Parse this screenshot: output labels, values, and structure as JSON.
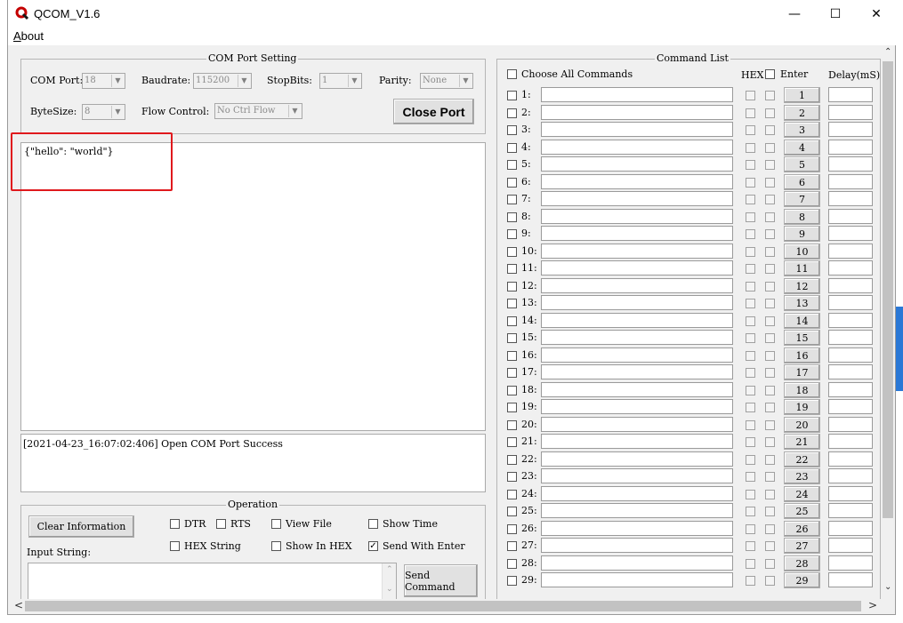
{
  "window": {
    "title": "QCOM_V1.6",
    "minimize_glyph": "—",
    "maximize_glyph": "☐",
    "close_glyph": "✕",
    "app_icon": "qcom-logo-icon"
  },
  "menu": {
    "about_label": "About"
  },
  "com_port_setting": {
    "title": "COM Port Setting",
    "com_port_label": "COM Port:",
    "com_port_value": "18",
    "baudrate_label": "Baudrate:",
    "baudrate_value": "115200",
    "stopbits_label": "StopBits:",
    "stopbits_value": "1",
    "parity_label": "Parity:",
    "parity_value": "None",
    "bytesize_label": "ByteSize:",
    "bytesize_value": "8",
    "flow_control_label": "Flow Control:",
    "flow_control_value": "No Ctrl Flow",
    "close_port_label": "Close Port"
  },
  "receive_text": "{\"hello\": \"world\"}",
  "log_text": "[2021-04-23_16:07:02:406] Open COM Port Success",
  "operation": {
    "title": "Operation",
    "clear_info_label": "Clear Information",
    "input_string_label": "Input String:",
    "send_command_label": "Send Command",
    "options": [
      {
        "label": "DTR",
        "checked": false
      },
      {
        "label": "RTS",
        "checked": false
      },
      {
        "label": "View File",
        "checked": false
      },
      {
        "label": "Show Time",
        "checked": false
      },
      {
        "label": "HEX String",
        "checked": false
      },
      {
        "label": "Show In HEX",
        "checked": false
      },
      {
        "label": "Send With Enter",
        "checked": true
      }
    ]
  },
  "command_list": {
    "title": "Command List",
    "choose_all_label": "Choose All Commands",
    "hex_label": "HEX",
    "enter_label": "Enter",
    "delay_label": "Delay(mS)",
    "rows": [
      "1:",
      "2:",
      "3:",
      "4:",
      "5:",
      "6:",
      "7:",
      "8:",
      "9:",
      "10:",
      "11:",
      "12:",
      "13:",
      "14:",
      "15:",
      "16:",
      "17:",
      "18:",
      "19:",
      "20:",
      "21:",
      "22:",
      "23:",
      "24:",
      "25:",
      "26:",
      "27:",
      "28:",
      "29:"
    ],
    "buttons": [
      "1",
      "2",
      "3",
      "4",
      "5",
      "6",
      "7",
      "8",
      "9",
      "10",
      "11",
      "12",
      "13",
      "14",
      "15",
      "16",
      "17",
      "18",
      "19",
      "20",
      "21",
      "22",
      "23",
      "24",
      "25",
      "26",
      "27",
      "28",
      "29"
    ]
  },
  "scrollbars": {
    "up_glyph": "⌃",
    "down_glyph": "⌄",
    "left_glyph": "<",
    "right_glyph": ">"
  }
}
